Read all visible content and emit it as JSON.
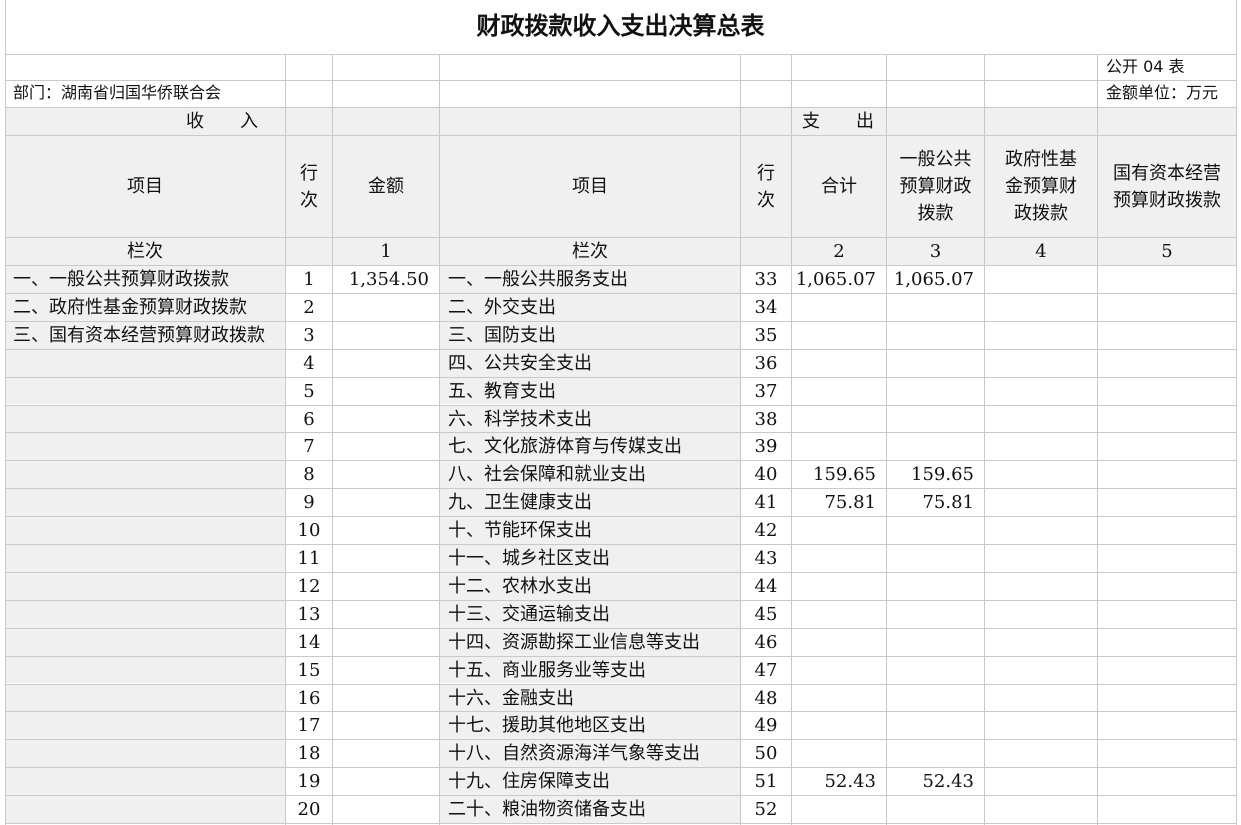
{
  "title": "财政拨款收入支出决算总表",
  "form_no": "公开 04 表",
  "department": "部门：湖南省归国华侨联合会",
  "unit": "金额单位：万元",
  "sections": {
    "income": "收　　入",
    "expense": "支　　出"
  },
  "headers": {
    "item": "项目",
    "row_no": "行次",
    "amount": "金额",
    "total": "合计",
    "general_budget": "一般公共预算财政拨款",
    "gov_fund": "政府性基金预算财政拨款",
    "state_capital": "国有资本经营预算财政拨款"
  },
  "column_index": {
    "label": "栏次",
    "amount": "1",
    "total": "2",
    "general_budget": "3",
    "gov_fund": "4",
    "state_capital": "5"
  },
  "rows": [
    {
      "income_item": "一、一般公共预算财政拨款",
      "income_row": "1",
      "income_amount": "1,354.50",
      "expense_item": "一、一般公共服务支出",
      "expense_row": "33",
      "total": "1,065.07",
      "general": "1,065.07",
      "fund": "",
      "capital": ""
    },
    {
      "income_item": "二、政府性基金预算财政拨款",
      "income_row": "2",
      "income_amount": "",
      "expense_item": "二、外交支出",
      "expense_row": "34",
      "total": "",
      "general": "",
      "fund": "",
      "capital": ""
    },
    {
      "income_item": "三、国有资本经营预算财政拨款",
      "income_row": "3",
      "income_amount": "",
      "expense_item": "三、国防支出",
      "expense_row": "35",
      "total": "",
      "general": "",
      "fund": "",
      "capital": ""
    },
    {
      "income_item": "",
      "income_row": "4",
      "income_amount": "",
      "expense_item": "四、公共安全支出",
      "expense_row": "36",
      "total": "",
      "general": "",
      "fund": "",
      "capital": ""
    },
    {
      "income_item": "",
      "income_row": "5",
      "income_amount": "",
      "expense_item": "五、教育支出",
      "expense_row": "37",
      "total": "",
      "general": "",
      "fund": "",
      "capital": ""
    },
    {
      "income_item": "",
      "income_row": "6",
      "income_amount": "",
      "expense_item": "六、科学技术支出",
      "expense_row": "38",
      "total": "",
      "general": "",
      "fund": "",
      "capital": ""
    },
    {
      "income_item": "",
      "income_row": "7",
      "income_amount": "",
      "expense_item": "七、文化旅游体育与传媒支出",
      "expense_row": "39",
      "total": "",
      "general": "",
      "fund": "",
      "capital": ""
    },
    {
      "income_item": "",
      "income_row": "8",
      "income_amount": "",
      "expense_item": "八、社会保障和就业支出",
      "expense_row": "40",
      "total": "159.65",
      "general": "159.65",
      "fund": "",
      "capital": ""
    },
    {
      "income_item": "",
      "income_row": "9",
      "income_amount": "",
      "expense_item": "九、卫生健康支出",
      "expense_row": "41",
      "total": "75.81",
      "general": "75.81",
      "fund": "",
      "capital": ""
    },
    {
      "income_item": "",
      "income_row": "10",
      "income_amount": "",
      "expense_item": "十、节能环保支出",
      "expense_row": "42",
      "total": "",
      "general": "",
      "fund": "",
      "capital": ""
    },
    {
      "income_item": "",
      "income_row": "11",
      "income_amount": "",
      "expense_item": "十一、城乡社区支出",
      "expense_row": "43",
      "total": "",
      "general": "",
      "fund": "",
      "capital": ""
    },
    {
      "income_item": "",
      "income_row": "12",
      "income_amount": "",
      "expense_item": "十二、农林水支出",
      "expense_row": "44",
      "total": "",
      "general": "",
      "fund": "",
      "capital": ""
    },
    {
      "income_item": "",
      "income_row": "13",
      "income_amount": "",
      "expense_item": "十三、交通运输支出",
      "expense_row": "45",
      "total": "",
      "general": "",
      "fund": "",
      "capital": ""
    },
    {
      "income_item": "",
      "income_row": "14",
      "income_amount": "",
      "expense_item": "十四、资源勘探工业信息等支出",
      "expense_row": "46",
      "total": "",
      "general": "",
      "fund": "",
      "capital": ""
    },
    {
      "income_item": "",
      "income_row": "15",
      "income_amount": "",
      "expense_item": "十五、商业服务业等支出",
      "expense_row": "47",
      "total": "",
      "general": "",
      "fund": "",
      "capital": ""
    },
    {
      "income_item": "",
      "income_row": "16",
      "income_amount": "",
      "expense_item": "十六、金融支出",
      "expense_row": "48",
      "total": "",
      "general": "",
      "fund": "",
      "capital": ""
    },
    {
      "income_item": "",
      "income_row": "17",
      "income_amount": "",
      "expense_item": "十七、援助其他地区支出",
      "expense_row": "49",
      "total": "",
      "general": "",
      "fund": "",
      "capital": ""
    },
    {
      "income_item": "",
      "income_row": "18",
      "income_amount": "",
      "expense_item": "十八、自然资源海洋气象等支出",
      "expense_row": "50",
      "total": "",
      "general": "",
      "fund": "",
      "capital": ""
    },
    {
      "income_item": "",
      "income_row": "19",
      "income_amount": "",
      "expense_item": "十九、住房保障支出",
      "expense_row": "51",
      "total": "52.43",
      "general": "52.43",
      "fund": "",
      "capital": ""
    },
    {
      "income_item": "",
      "income_row": "20",
      "income_amount": "",
      "expense_item": "二十、粮油物资储备支出",
      "expense_row": "52",
      "total": "",
      "general": "",
      "fund": "",
      "capital": ""
    }
  ]
}
